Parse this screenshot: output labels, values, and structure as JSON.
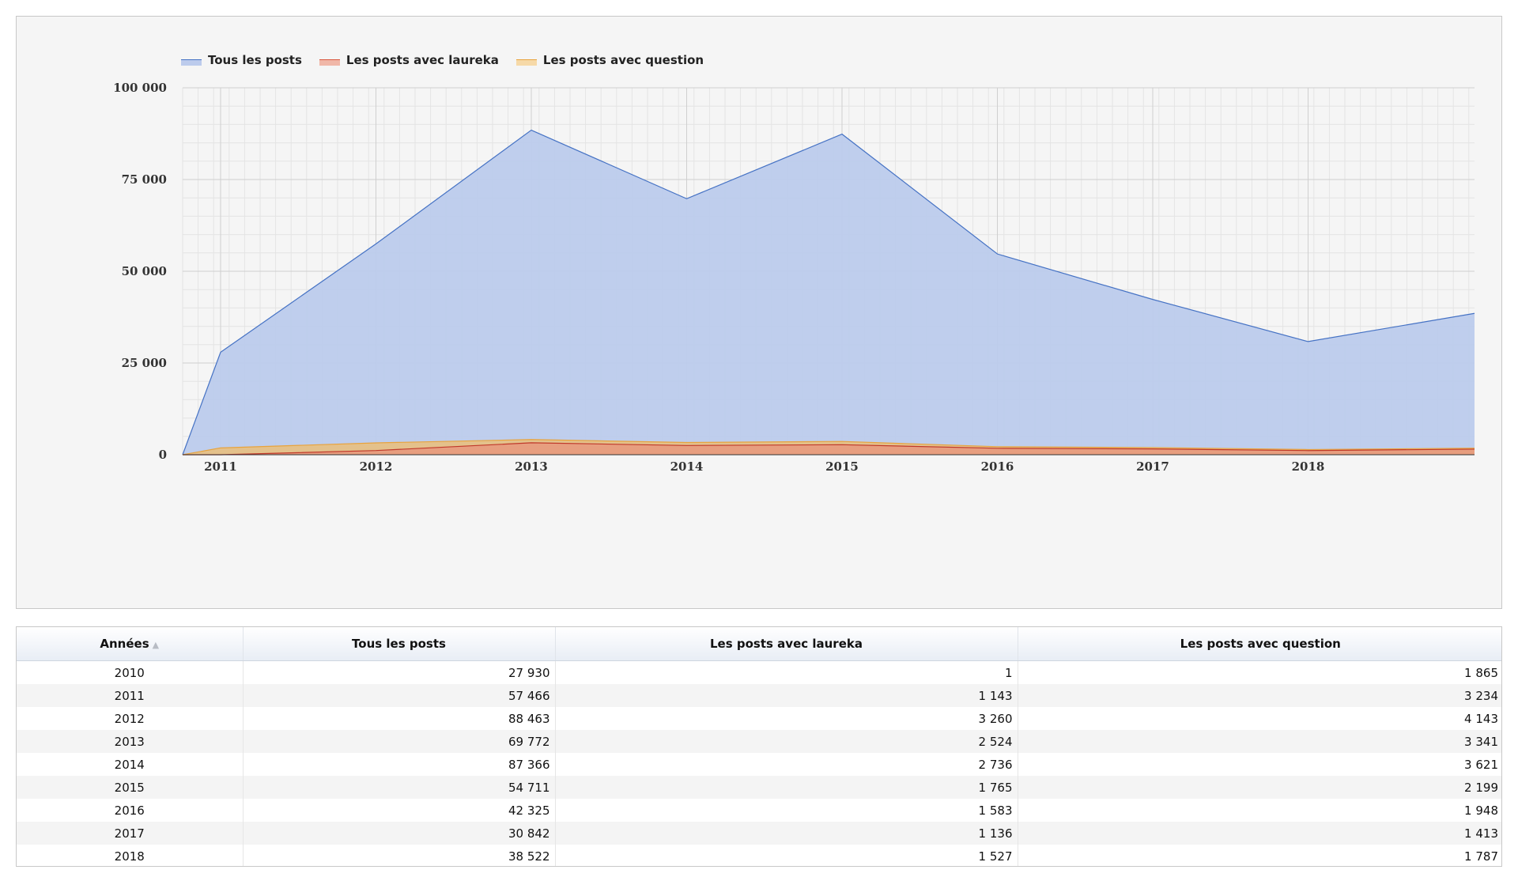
{
  "chart_data": {
    "type": "area",
    "x": [
      "2010",
      "2011",
      "2012",
      "2013",
      "2014",
      "2015",
      "2016",
      "2017",
      "2018"
    ],
    "x_tick_labels": [
      "2011",
      "2012",
      "2013",
      "2014",
      "2015",
      "2016",
      "2017",
      "2018"
    ],
    "y_tick_labels": [
      "100 000",
      "75 000",
      "50 000",
      "25 000",
      "0"
    ],
    "y_ticks": [
      100000,
      75000,
      50000,
      25000,
      0
    ],
    "ylim": [
      0,
      100000
    ],
    "grid": true,
    "legend_position": "top-left",
    "series": [
      {
        "name": "Tous les posts",
        "color": "#4572c4",
        "fill": "#bccbec",
        "values": [
          0,
          27930,
          57466,
          88463,
          69772,
          87366,
          54711,
          42325,
          30842,
          38522
        ]
      },
      {
        "name": "Les posts avec laureka",
        "color": "#c0392b",
        "fill": "#e79a7d",
        "values": [
          0,
          1,
          1143,
          3260,
          2524,
          2736,
          1765,
          1583,
          1136,
          1527
        ]
      },
      {
        "name": "Les posts avec question",
        "color": "#e8a33d",
        "fill": "#e8c080",
        "values": [
          0,
          1865,
          3234,
          4143,
          3341,
          3621,
          2199,
          1948,
          1413,
          1787
        ]
      }
    ]
  },
  "table": {
    "headers": [
      "Années",
      "Tous les posts",
      "Les posts avec laureka",
      "Les posts avec question"
    ],
    "sort_icon": "sort-up-icon",
    "rows": [
      [
        "2010",
        "27 930",
        "1",
        "1 865"
      ],
      [
        "2011",
        "57 466",
        "1 143",
        "3 234"
      ],
      [
        "2012",
        "88 463",
        "3 260",
        "4 143"
      ],
      [
        "2013",
        "69 772",
        "2 524",
        "3 341"
      ],
      [
        "2014",
        "87 366",
        "2 736",
        "3 621"
      ],
      [
        "2015",
        "54 711",
        "1 765",
        "2 199"
      ],
      [
        "2016",
        "42 325",
        "1 583",
        "1 948"
      ],
      [
        "2017",
        "30 842",
        "1 136",
        "1 413"
      ],
      [
        "2018",
        "38 522",
        "1 527",
        "1 787"
      ]
    ]
  }
}
